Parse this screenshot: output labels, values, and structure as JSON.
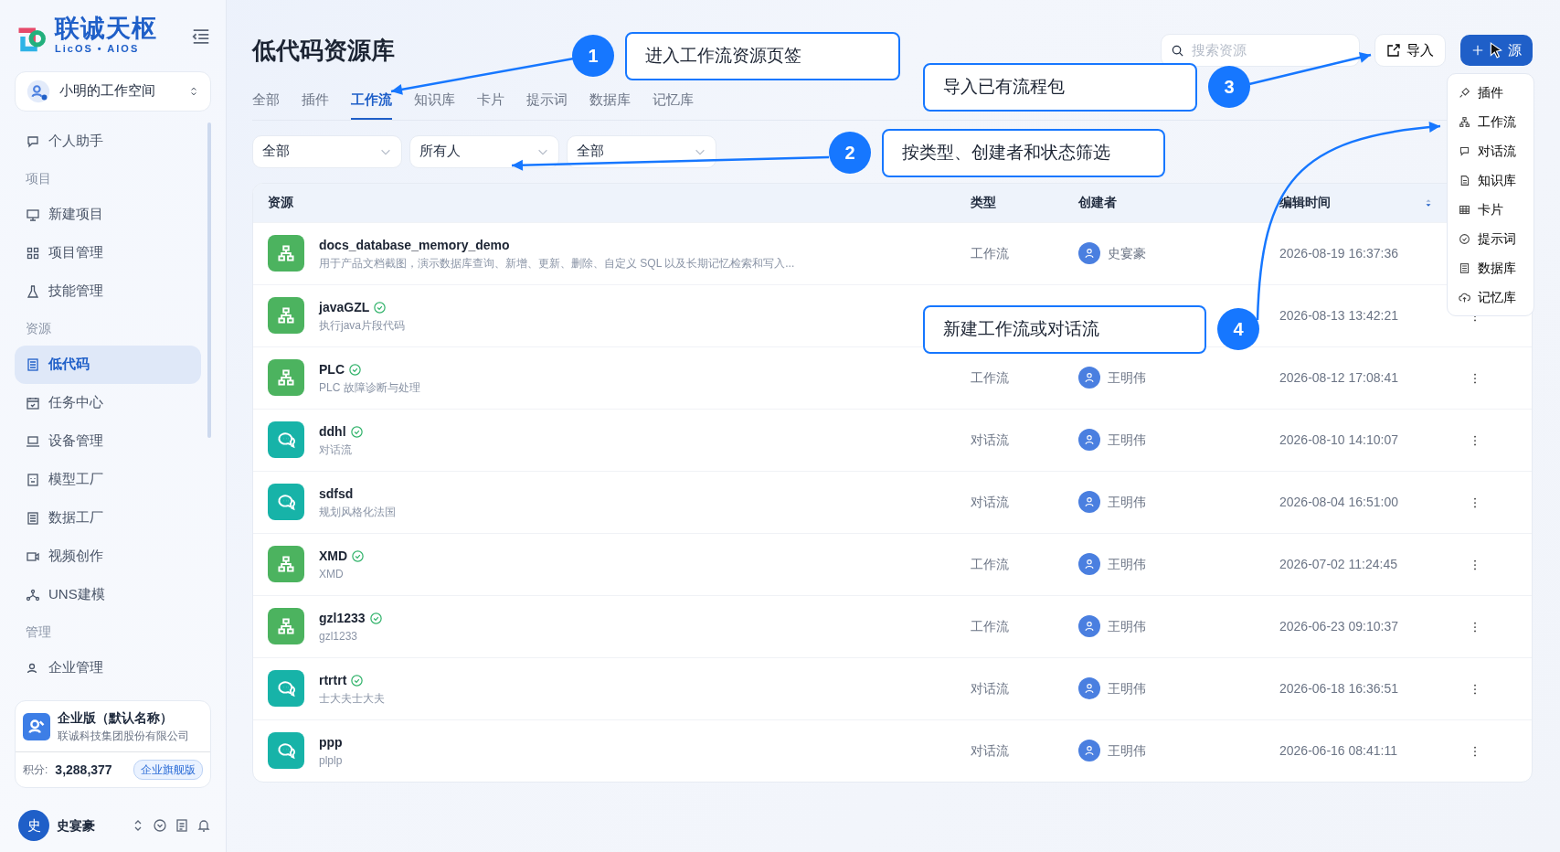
{
  "sidebar": {
    "logo": {
      "title": "联诚天枢",
      "subtitle": "LicOS • AIOS"
    },
    "workspace": "小明的工作空间",
    "menu": [
      {
        "kind": "item",
        "label": "个人助手",
        "selected": false
      },
      {
        "kind": "section",
        "label": "项目"
      },
      {
        "kind": "item",
        "label": "新建项目",
        "selected": false
      },
      {
        "kind": "item",
        "label": "项目管理",
        "selected": false
      },
      {
        "kind": "item",
        "label": "技能管理",
        "selected": false
      },
      {
        "kind": "section",
        "label": "资源"
      },
      {
        "kind": "item",
        "label": "低代码",
        "selected": true
      },
      {
        "kind": "item",
        "label": "任务中心",
        "selected": false
      },
      {
        "kind": "item",
        "label": "设备管理",
        "selected": false
      },
      {
        "kind": "item",
        "label": "模型工厂",
        "selected": false
      },
      {
        "kind": "item",
        "label": "数据工厂",
        "selected": false
      },
      {
        "kind": "item",
        "label": "视频创作",
        "selected": false
      },
      {
        "kind": "item",
        "label": "UNS建模",
        "selected": false
      },
      {
        "kind": "section",
        "label": "管理"
      },
      {
        "kind": "item",
        "label": "企业管理",
        "selected": false
      }
    ],
    "enterprise": {
      "title": "企业版（默认名称）",
      "company": "联诚科技集团股份有限公司",
      "points_label": "积分:",
      "points": "3,288,377",
      "badge": "企业旗舰版"
    },
    "user": {
      "avatar": "史",
      "name": "史宴豪"
    }
  },
  "header": {
    "title": "低代码资源库",
    "search": {
      "placeholder": "搜索资源"
    },
    "import_button": "导入",
    "new_button": "源",
    "new_menu": [
      "插件",
      "工作流",
      "对话流",
      "知识库",
      "卡片",
      "提示词",
      "数据库",
      "记忆库"
    ]
  },
  "tabs": [
    {
      "label": "全部",
      "selected": false
    },
    {
      "label": "插件",
      "selected": false
    },
    {
      "label": "工作流",
      "selected": true
    },
    {
      "label": "知识库",
      "selected": false
    },
    {
      "label": "卡片",
      "selected": false
    },
    {
      "label": "提示词",
      "selected": false
    },
    {
      "label": "数据库",
      "selected": false
    },
    {
      "label": "记忆库",
      "selected": false
    }
  ],
  "filters": [
    {
      "value": "全部"
    },
    {
      "value": "所有人"
    },
    {
      "value": "全部"
    }
  ],
  "table": {
    "columns": [
      "资源",
      "类型",
      "创建者",
      "编辑时间"
    ],
    "rows": [
      {
        "kind": "workflow",
        "name": "docs_database_memory_demo",
        "verified": false,
        "description": "用于产品文档截图，演示数据库查询、新增、更新、删除、自定义 SQL 以及长期记忆检索和写入...",
        "type": "工作流",
        "creator": "史宴豪",
        "time": "2026-08-19 16:37:36"
      },
      {
        "kind": "workflow",
        "name": "javaGZL",
        "verified": true,
        "description": "执行java片段代码",
        "time": "2026-08-13 13:42:21"
      },
      {
        "kind": "workflow",
        "name": "PLC",
        "verified": true,
        "description": "PLC 故障诊断与处理",
        "type": "工作流",
        "creator": "王明伟",
        "time": "2026-08-12 17:08:41"
      },
      {
        "kind": "chat",
        "name": "ddhl",
        "verified": true,
        "description": "对话流",
        "type": "对话流",
        "creator": "王明伟",
        "time": "2026-08-10 14:10:07"
      },
      {
        "kind": "chat",
        "name": "sdfsd",
        "verified": false,
        "description": "规划风格化法国",
        "type": "对话流",
        "creator": "王明伟",
        "time": "2026-08-04 16:51:00"
      },
      {
        "kind": "workflow",
        "name": "XMD",
        "verified": true,
        "description": "XMD",
        "type": "工作流",
        "creator": "王明伟",
        "time": "2026-07-02 11:24:45"
      },
      {
        "kind": "workflow",
        "name": "gzl1233",
        "verified": true,
        "description": "gzl1233",
        "type": "工作流",
        "creator": "王明伟",
        "time": "2026-06-23 09:10:37"
      },
      {
        "kind": "chat",
        "name": "rtrtrt",
        "verified": true,
        "description": "士大夫士大夫",
        "type": "对话流",
        "creator": "王明伟",
        "time": "2026-06-18 16:36:51"
      },
      {
        "kind": "chat",
        "name": "ppp",
        "verified": false,
        "description": "plplp",
        "type": "对话流",
        "creator": "王明伟",
        "time": "2026-06-16 08:41:11"
      }
    ]
  },
  "annotations": [
    {
      "number": "1",
      "text": "进入工作流资源页签"
    },
    {
      "number": "3",
      "text": "导入已有流程包"
    },
    {
      "number": "2",
      "text": "按类型、创建者和状态筛选"
    },
    {
      "number": "4",
      "text": "新建工作流或对话流"
    }
  ]
}
